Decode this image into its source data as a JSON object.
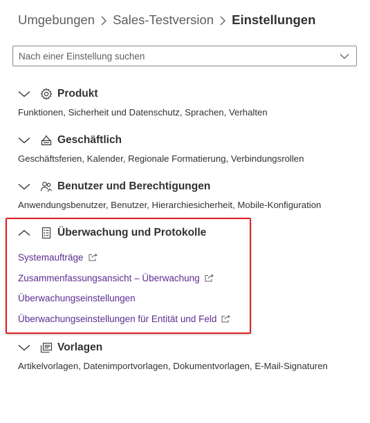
{
  "breadcrumb": {
    "items": [
      "Umgebungen",
      "Sales-Testversion"
    ],
    "current": "Einstellungen"
  },
  "search": {
    "placeholder": "Nach einer Einstellung suchen"
  },
  "sections": [
    {
      "title": "Produkt",
      "icon": "gear-icon",
      "expanded": false,
      "description": "Funktionen, Sicherheit und Datenschutz, Sprachen, Verhalten"
    },
    {
      "title": "Geschäftlich",
      "icon": "building-icon",
      "expanded": false,
      "description": "Geschäftsferien, Kalender, Regionale Formatierung, Verbindungsrollen"
    },
    {
      "title": "Benutzer und Berechtigungen",
      "icon": "people-icon",
      "expanded": false,
      "description": "Anwendungsbenutzer, Benutzer, Hierarchiesicherheit, Mobile-Konfiguration"
    },
    {
      "title": "Überwachung und Protokolle",
      "icon": "clipboard-list-icon",
      "expanded": true,
      "links": [
        {
          "label": "Systemaufträge",
          "external": true
        },
        {
          "label": "Zusammenfassungsansicht – Überwachung",
          "external": true
        },
        {
          "label": "Überwachungseinstellungen",
          "external": false
        },
        {
          "label": "Überwachungseinstellungen für Entität und Feld",
          "external": true
        }
      ]
    },
    {
      "title": "Vorlagen",
      "icon": "template-icon",
      "expanded": false,
      "description": "Artikelvorlagen, Datenimportvorlagen, Dokumentvorlagen, E-Mail-Signaturen"
    }
  ],
  "colors": {
    "link": "#5c2d91",
    "highlight": "#e02020",
    "text": "#323130"
  }
}
